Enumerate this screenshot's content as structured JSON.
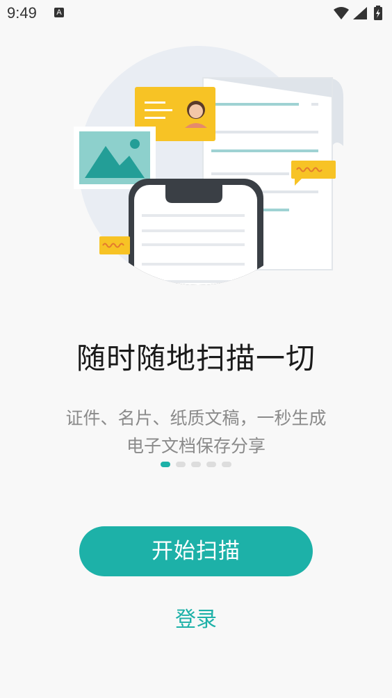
{
  "status_bar": {
    "time": "9:49",
    "notification_icon": "A",
    "icons": [
      "wifi-icon",
      "signal-icon",
      "battery-charging-icon"
    ]
  },
  "onboarding": {
    "title": "随时随地扫描一切",
    "subtitle_line1": "证件、名片、纸质文稿，一秒生成",
    "subtitle_line2": "电子文档保存分享",
    "page_count": 5,
    "current_page": 1
  },
  "actions": {
    "start_label": "开始扫描",
    "login_label": "登录"
  },
  "colors": {
    "accent": "#1db1a8",
    "card_yellow": "#f7c325",
    "circle_bg": "#e9edf3",
    "phone_frame": "#3a3f45"
  }
}
